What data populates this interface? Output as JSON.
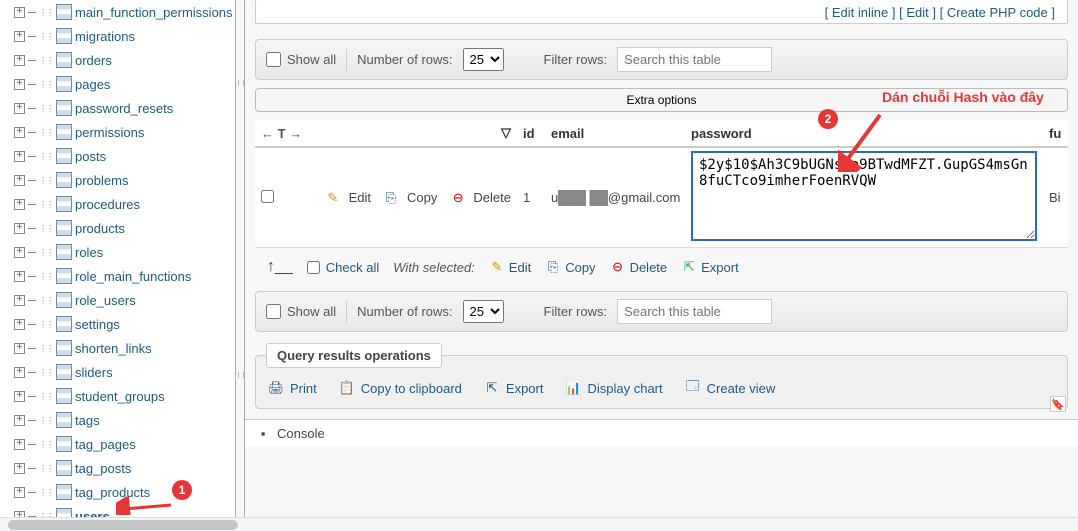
{
  "sidebar": {
    "items": [
      {
        "label": "main_function_permissions"
      },
      {
        "label": "migrations"
      },
      {
        "label": "orders"
      },
      {
        "label": "pages"
      },
      {
        "label": "password_resets"
      },
      {
        "label": "permissions"
      },
      {
        "label": "posts"
      },
      {
        "label": "problems"
      },
      {
        "label": "procedures"
      },
      {
        "label": "products"
      },
      {
        "label": "roles"
      },
      {
        "label": "role_main_functions"
      },
      {
        "label": "role_users"
      },
      {
        "label": "settings"
      },
      {
        "label": "shorten_links"
      },
      {
        "label": "sliders"
      },
      {
        "label": "student_groups"
      },
      {
        "label": "tags"
      },
      {
        "label": "tag_pages"
      },
      {
        "label": "tag_posts"
      },
      {
        "label": "tag_products"
      },
      {
        "label": "users"
      }
    ]
  },
  "top_links": {
    "edit_inline": "Edit inline",
    "edit": "Edit",
    "create_php": "Create PHP code"
  },
  "toolbar": {
    "show_all": "Show all",
    "num_rows": "Number of rows:",
    "row_options": [
      "25"
    ],
    "filter_label": "Filter rows:",
    "filter_ph": "Search this table"
  },
  "extra_options": "Extra options",
  "columns": {
    "t": "← T →",
    "id": "id",
    "email": "email",
    "password": "password",
    "last": "fu"
  },
  "row": {
    "edit": "Edit",
    "copy": "Copy",
    "delete": "Delete",
    "id": "1",
    "user_first": "u",
    "email_suffix": "@gmail.com",
    "hash": "$2y$10$Ah3C9bUGNsOo9BTwdMFZT.GupGS4msGn8fuCTco9imherFoenRVQW",
    "last_col": "Bi"
  },
  "selection": {
    "check_all": "Check all",
    "with_selected": "With selected:",
    "edit": "Edit",
    "copy": "Copy",
    "delete": "Delete",
    "export": "Export"
  },
  "qro": {
    "title": "Query results operations",
    "print": "Print",
    "copy_clip": "Copy to clipboard",
    "export": "Export",
    "display_chart": "Display chart",
    "create_view": "Create view"
  },
  "console": "Console",
  "anno": {
    "one": "1",
    "two": "2",
    "hash_text": "Dán chuỗi Hash vào đây"
  }
}
